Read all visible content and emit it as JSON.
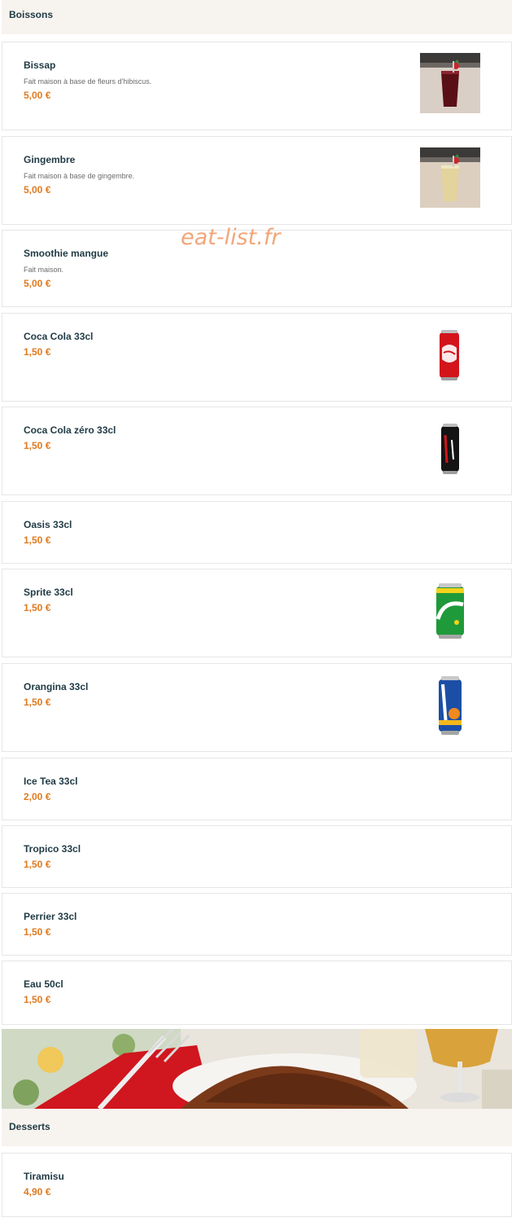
{
  "sections": {
    "boissons": "Boissons",
    "desserts": "Desserts"
  },
  "watermark": "eat-list.fr",
  "items": [
    {
      "name": "Bissap",
      "desc": "Fait maison à base de fleurs d'hibiscus.",
      "price": "5,00 €",
      "image": "red-drink-glass"
    },
    {
      "name": "Gingembre",
      "desc": "Fait maison à base de gingembre.",
      "price": "5,00 €",
      "image": "ginger-drink-glass"
    },
    {
      "name": "Smoothie mangue",
      "desc": "Fait maison.",
      "price": "5,00 €"
    },
    {
      "name": "Coca Cola 33cl",
      "price": "1,50 €",
      "image": "coca-cola-can"
    },
    {
      "name": "Coca Cola zéro 33cl",
      "price": "1,50 €",
      "image": "coca-cola-zero-can"
    },
    {
      "name": "Oasis 33cl",
      "price": "1,50 €"
    },
    {
      "name": "Sprite 33cl",
      "price": "1,50 €",
      "image": "sprite-can"
    },
    {
      "name": "Orangina 33cl",
      "price": "1,50 €",
      "image": "orangina-can"
    },
    {
      "name": "Ice Tea 33cl",
      "price": "2,00 €"
    },
    {
      "name": "Tropico 33cl",
      "price": "1,50 €"
    },
    {
      "name": "Perrier 33cl",
      "price": "1,50 €"
    },
    {
      "name": "Eau 50cl",
      "price": "1,50 €"
    },
    {
      "name": "Tiramisu",
      "price": "4,90 €"
    }
  ],
  "banner": {
    "image": "tiramisu-banner-photo"
  },
  "colors": {
    "price": "#e07a1f",
    "name": "#1f3a44",
    "section_bg": "#f7f3ef"
  }
}
